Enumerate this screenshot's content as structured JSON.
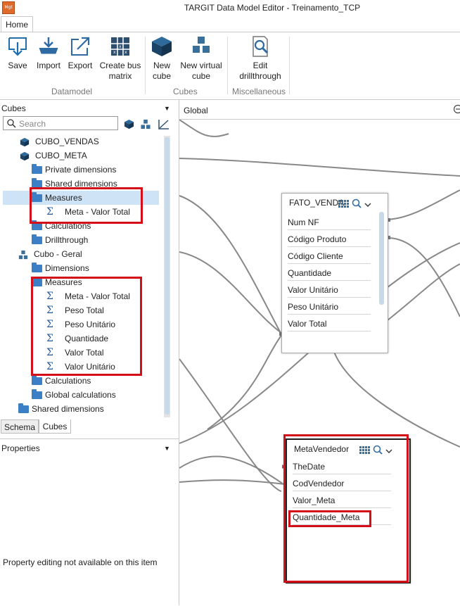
{
  "window": {
    "title": "TARGIT Data Model Editor - Treinamento_TCP",
    "app_icon_text": "Mgt"
  },
  "tabs": {
    "home": "Home"
  },
  "ribbon": {
    "save": "Save",
    "import": "Import",
    "export": "Export",
    "create_bus_line1": "Create bus",
    "create_bus_line2": "matrix",
    "new_cube_line1": "New",
    "new_cube_line2": "cube",
    "new_virtual_line1": "New virtual",
    "new_virtual_line2": "cube",
    "edit_line1": "Edit",
    "edit_line2": "drillthrough",
    "group_datamodel": "Datamodel",
    "group_cubes": "Cubes",
    "group_misc": "Miscellaneous"
  },
  "cubes_panel": {
    "header": "Cubes",
    "search_placeholder": "Search",
    "tree": {
      "cubo_vendas": "CUBO_VENDAS",
      "cubo_meta": "CUBO_META",
      "private_dimensions": "Private dimensions",
      "shared_dimensions_1": "Shared dimensions",
      "measures_1": "Measures",
      "meta_valor_total_1": "Meta - Valor Total",
      "calculations_1": "Calculations",
      "drillthrough": "Drillthrough",
      "cubo_geral": "Cubo - Geral",
      "dimensions": "Dimensions",
      "measures_2": "Measures",
      "meta_valor_total_2": "Meta - Valor Total",
      "peso_total": "Peso Total",
      "peso_unitario": "Peso Unitário",
      "quantidade": "Quantidade",
      "valor_total": "Valor Total",
      "valor_unitario": "Valor Unitário",
      "calculations_2": "Calculations",
      "global_calculations": "Global calculations",
      "shared_dimensions_root": "Shared dimensions"
    },
    "bottom_tabs": {
      "schema": "Schema",
      "cubes": "Cubes"
    }
  },
  "properties_panel": {
    "header": "Properties",
    "message": "Property editing not available on this item"
  },
  "canvas": {
    "title": "Global",
    "fato_vendas": {
      "title": "FATO_VENDA",
      "fields": [
        "Num NF",
        "Código Produto",
        "Código Cliente",
        "Quantidade",
        "Valor Unitário",
        "Peso Unitário",
        "Valor Total"
      ]
    },
    "meta_vendedor": {
      "title": "MetaVendedor",
      "fields": [
        "TheDate",
        "CodVendedor",
        "Valor_Meta",
        "Quantidade_Meta"
      ]
    }
  },
  "colors": {
    "highlight_red": "#d40f1a",
    "folder_blue": "#3d7fc5",
    "cube_blue": "#1f4f7a",
    "selection": "#cfe3f6"
  }
}
